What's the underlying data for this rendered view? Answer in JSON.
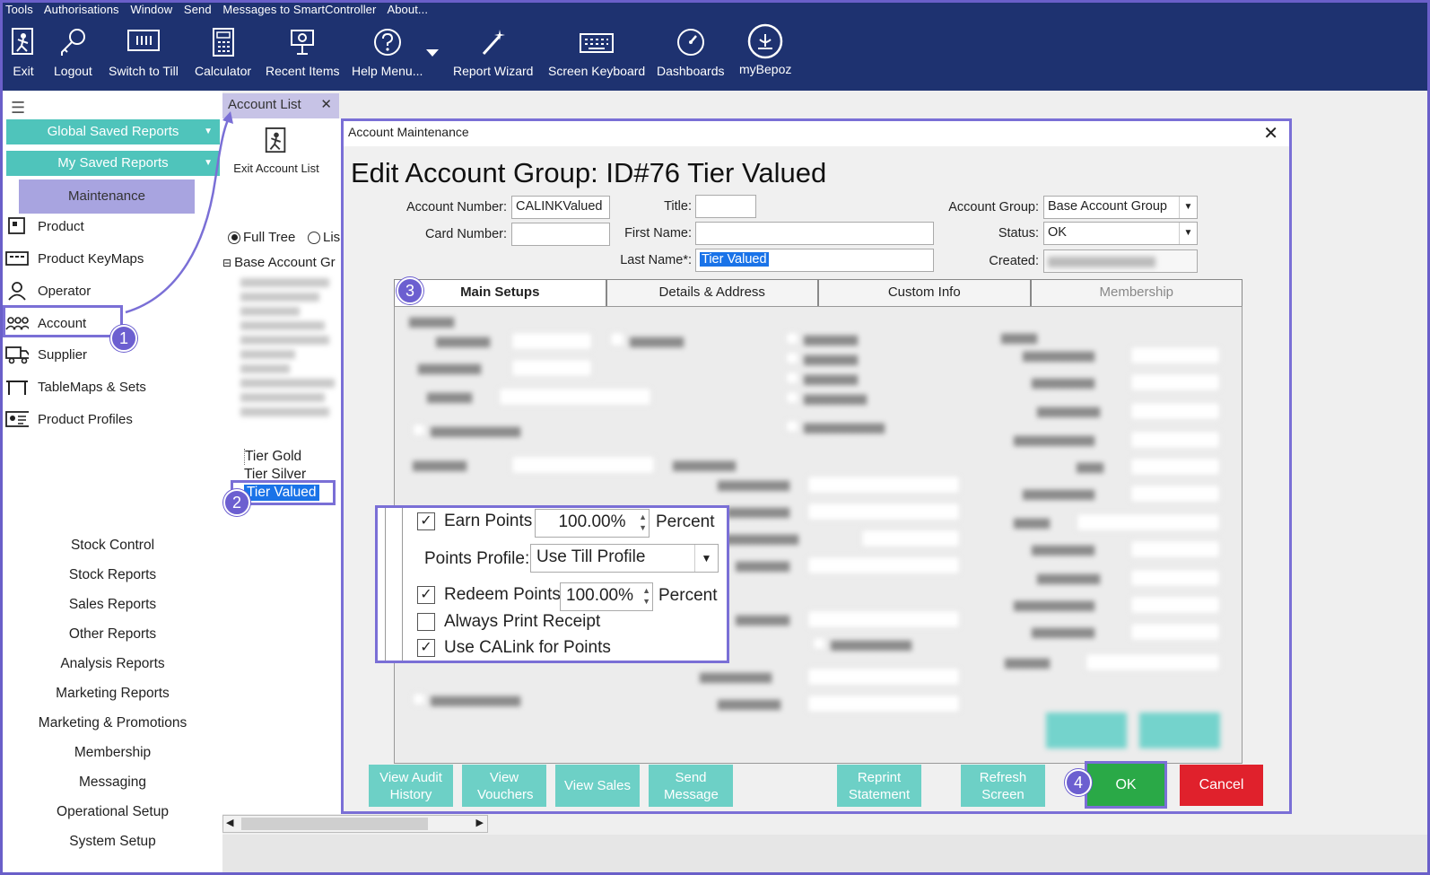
{
  "menubar": [
    "Tools",
    "Authorisations",
    "Window",
    "Send",
    "Messages to SmartController",
    "About..."
  ],
  "toolbar": [
    {
      "label": "Exit",
      "icon": "exit-icon"
    },
    {
      "label": "Logout",
      "icon": "key-icon"
    },
    {
      "label": "Switch to Till",
      "icon": "till-icon"
    },
    {
      "label": "Calculator",
      "icon": "calculator-icon"
    },
    {
      "label": "Recent Items",
      "icon": "recent-icon"
    },
    {
      "label": "Help Menu...",
      "icon": "help-icon"
    },
    {
      "label": "Report Wizard",
      "icon": "wand-icon"
    },
    {
      "label": "Screen Keyboard",
      "icon": "keyboard-icon"
    },
    {
      "label": "Dashboards",
      "icon": "gauge-icon"
    },
    {
      "label": "myBepoz",
      "icon": "bepoz-icon"
    }
  ],
  "sidebar": {
    "global_saved_reports": "Global Saved Reports",
    "my_saved_reports": "My Saved Reports",
    "maintenance": "Maintenance",
    "items": [
      "Product",
      "Product KeyMaps",
      "Operator",
      "Account",
      "Supplier",
      "TableMaps & Sets",
      "Product Profiles"
    ],
    "menu": [
      "Stock Control",
      "Stock Reports",
      "Sales Reports",
      "Other Reports",
      "Analysis Reports",
      "Marketing Reports",
      "Marketing & Promotions",
      "Membership",
      "Messaging",
      "Operational Setup",
      "System Setup"
    ]
  },
  "account_list": {
    "tab_label": "Account List",
    "exit_label": "Exit Account List",
    "radio_full_tree": "Full Tree",
    "radio_list": "Lis",
    "tree_root": "Base Account Gr",
    "tree_items": [
      "Tier Gold",
      "Tier Silver",
      "Tier Valued"
    ]
  },
  "dialog": {
    "title": "Account Maintenance",
    "heading": "Edit Account Group: ID#76 Tier Valued",
    "account_number_label": "Account Number:",
    "account_number": "CALINKValued",
    "card_number_label": "Card Number:",
    "card_number": "",
    "title_label": "Title:",
    "title_value": "",
    "first_name_label": "First Name:",
    "first_name": "",
    "last_name_label": "Last Name*:",
    "last_name": "Tier Valued",
    "account_group_label": "Account Group:",
    "account_group": "Base Account Group",
    "status_label": "Status:",
    "status": "OK",
    "created_label": "Created:",
    "tabs": [
      "Main Setups",
      "Details & Address",
      "Custom Info",
      "Membership"
    ],
    "points": {
      "earn_points_label": "Earn Points",
      "earn_points_value": "100.00%",
      "earn_unit": "Percent",
      "earn_checked": true,
      "points_profile_label": "Points Profile:",
      "points_profile": "Use Till Profile",
      "redeem_points_label": "Redeem Points",
      "redeem_points_value": "100.00%",
      "redeem_unit": "Percent",
      "redeem_checked": true,
      "always_print_label": "Always Print Receipt",
      "always_print_checked": false,
      "calink_label": "Use CALink for Points",
      "calink_checked": true
    },
    "buttons": {
      "view_audit_history": "View Audit History",
      "view_vouchers": "View Vouchers",
      "view_sales": "View Sales",
      "send_message": "Send Message",
      "reprint_statement": "Reprint Statement",
      "refresh_screen": "Refresh Screen",
      "ok": "OK",
      "cancel": "Cancel"
    }
  },
  "callouts": [
    "1",
    "2",
    "3",
    "4"
  ],
  "colors": {
    "topbar": "#1e3270",
    "teal": "#4fc4bb",
    "highlight": "#7a6fd6",
    "ok": "#2aa947",
    "cancel": "#e0212c"
  }
}
